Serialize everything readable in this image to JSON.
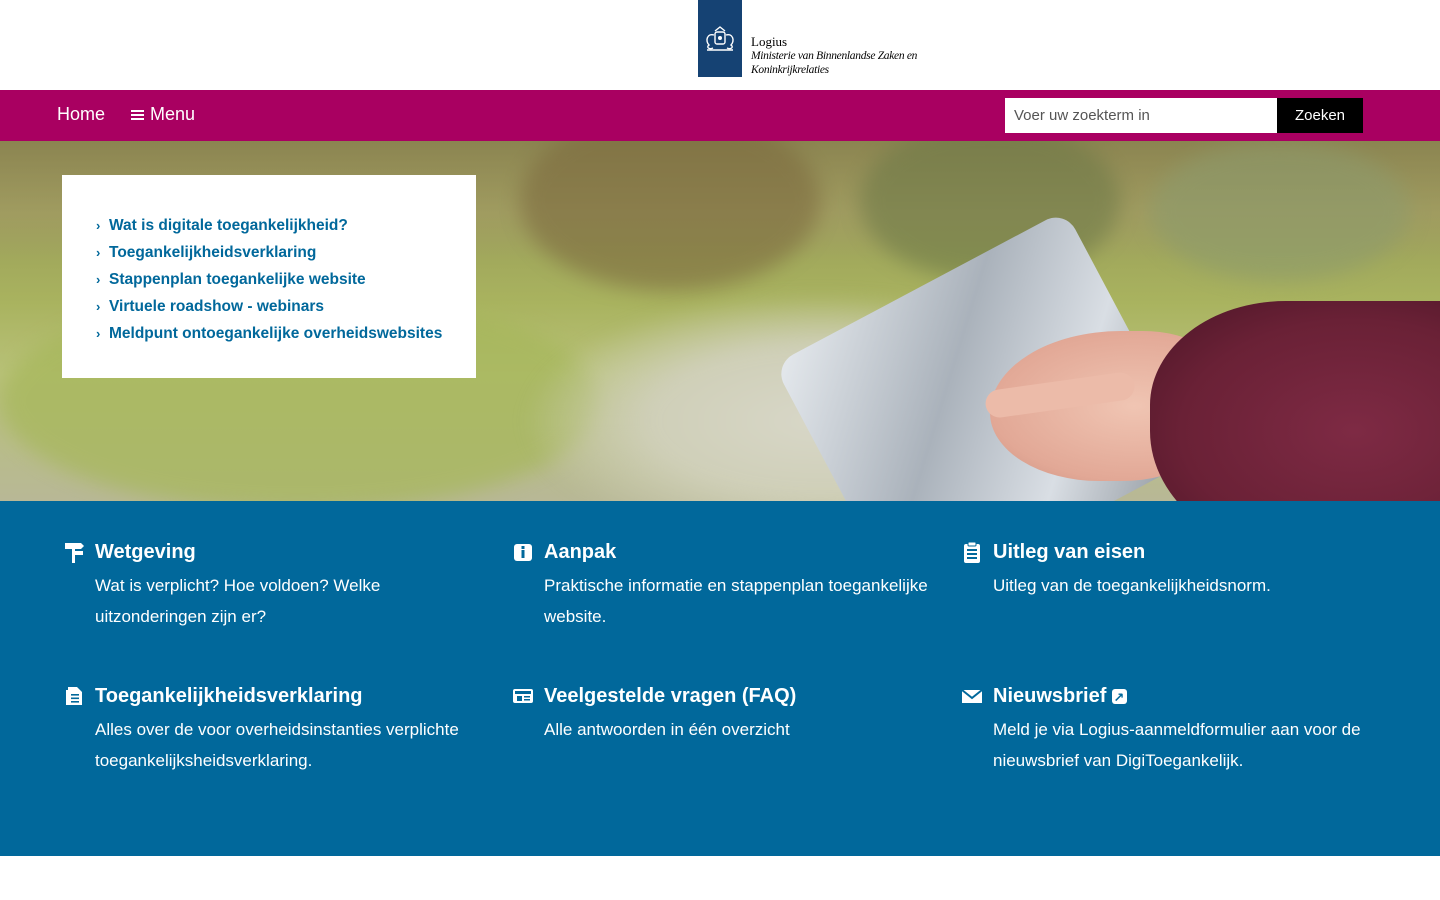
{
  "header": {
    "org_name": "Logius",
    "ministry_line1": "Ministerie van Binnenlandse Zaken en",
    "ministry_line2": "Koninkrijkrelaties",
    "logo_icon": "rijksoverheid-coat-of-arms-icon",
    "logo_color": "#154273"
  },
  "nav": {
    "home_label": "Home",
    "menu_label": "Menu",
    "search_placeholder": "Voer uw zoekterm in",
    "search_button": "Zoeken",
    "bar_color": "#a90061"
  },
  "quicklinks": [
    {
      "label": "Wat is digitale toegankelijkheid?"
    },
    {
      "label": "Toegankelijkheidsverklaring"
    },
    {
      "label": "Stappenplan toegankelijke website"
    },
    {
      "label": "Virtuele roadshow - webinars"
    },
    {
      "label": "Meldpunt ontoegankelijke overheidswebsites"
    }
  ],
  "tiles": [
    {
      "title": "Wetgeving",
      "text": "Wat is verplicht? Hoe voldoen? Welke uitzonderingen zijn er?",
      "icon": "signpost-icon"
    },
    {
      "title": "Aanpak",
      "text": "Praktische informatie en stappenplan toegankelijke website.",
      "icon": "info-icon"
    },
    {
      "title": "Uitleg van eisen",
      "text": "Uitleg van de toegankelijkheidsnorm.",
      "icon": "clipboard-checklist-icon"
    },
    {
      "title": "Toegankelijkheidsverklaring",
      "text": "Alles over de voor overheidsinstanties verplichte toegankelijksheidsverklaring.",
      "icon": "document-icon"
    },
    {
      "title": "Veelgestelde vragen (FAQ)",
      "text": "Alle antwoorden in één overzicht",
      "icon": "newspaper-icon"
    },
    {
      "title": "Nieuwsbrief",
      "text": "Meld je via Logius-aanmeldformulier aan voor de nieuwsbrief van DigiToegankelijk.",
      "icon": "envelope-icon",
      "external_icon": "external-link-icon"
    }
  ],
  "colors": {
    "tiles_background": "#01689b",
    "link_color": "#01689b"
  }
}
